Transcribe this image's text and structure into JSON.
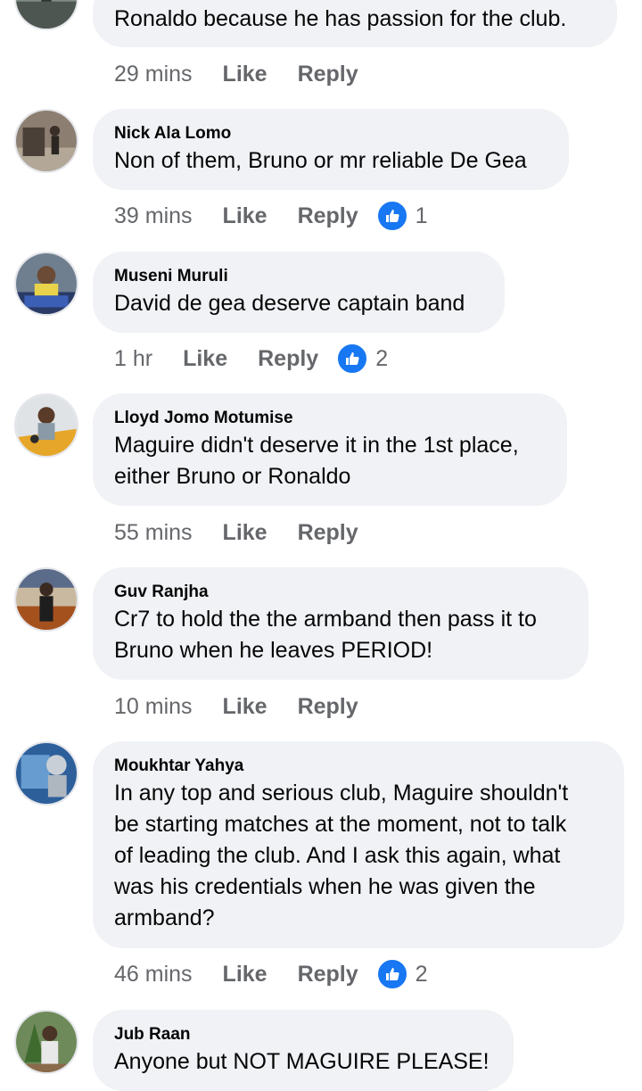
{
  "comments": [
    {
      "id": "c0",
      "name": "",
      "text": "Ronaldo because he has passion for the club.",
      "time": "29 mins",
      "like_label": "Like",
      "reply_label": "Reply",
      "reaction_count": null,
      "avatar_icon": "avatar-photo-icon"
    },
    {
      "id": "c1",
      "name": "Nick Ala Lomo",
      "text": "Non of them, Bruno or mr reliable De Gea",
      "time": "39 mins",
      "like_label": "Like",
      "reply_label": "Reply",
      "reaction_count": "1",
      "avatar_icon": "avatar-photo-icon"
    },
    {
      "id": "c2",
      "name": "Museni Muruli",
      "text": "David de gea deserve captain band",
      "time": "1 hr",
      "like_label": "Like",
      "reply_label": "Reply",
      "reaction_count": "2",
      "avatar_icon": "avatar-photo-icon"
    },
    {
      "id": "c3",
      "name": "Lloyd Jomo Motumise",
      "text": "Maguire didn't deserve it in the 1st place,\neither Bruno or Ronaldo",
      "time": "55 mins",
      "like_label": "Like",
      "reply_label": "Reply",
      "reaction_count": null,
      "avatar_icon": "avatar-photo-icon"
    },
    {
      "id": "c4",
      "name": "Guv Ranjha",
      "text": "Cr7 to hold the the armband then pass it to\nBruno when he leaves PERIOD!",
      "time": "10 mins",
      "like_label": "Like",
      "reply_label": "Reply",
      "reaction_count": null,
      "avatar_icon": "avatar-photo-icon"
    },
    {
      "id": "c5",
      "name": "Moukhtar Yahya",
      "text": "In any top and serious club, Maguire shouldn't\nbe starting matches at the moment, not to talk\nof leading the club. And I ask this again, what\nwas his credentials when he was given the\narmband?",
      "time": "46 mins",
      "like_label": "Like",
      "reply_label": "Reply",
      "reaction_count": "2",
      "avatar_icon": "avatar-photo-icon"
    },
    {
      "id": "c6",
      "name": "Jub Raan",
      "text": "Anyone but NOT MAGUIRE PLEASE!",
      "time": "",
      "like_label": "",
      "reply_label": "",
      "reaction_count": null,
      "avatar_icon": "avatar-photo-icon"
    }
  ],
  "colors": {
    "bubble_bg": "#f0f2f5",
    "action_text": "#65676b",
    "like_blue": "#1877f2"
  }
}
